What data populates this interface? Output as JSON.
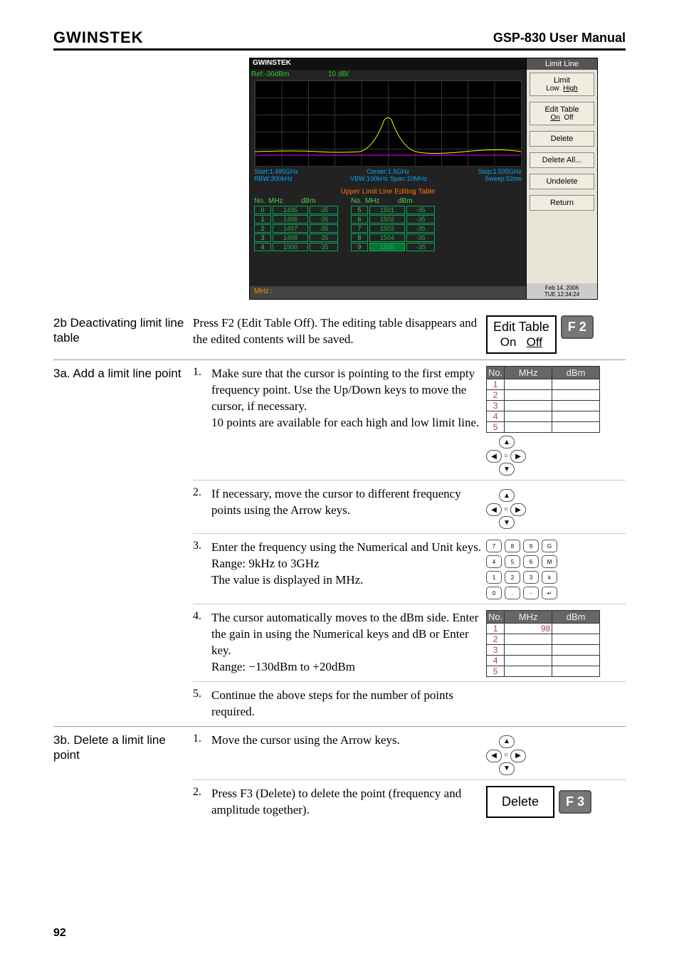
{
  "header": {
    "logo": "GWINSTEK",
    "title": "GSP-830 User Manual"
  },
  "screenshot": {
    "logo": "GWINSTEK",
    "ref": "Ref:-30dBm",
    "scale": "10 dB/",
    "info_l": "Start:1.495GHz",
    "info_c": "Center:1.5GHz",
    "info_r": "Stop:1.505GHz",
    "info_l2": "RBW:300kHz",
    "info_c2": "VBW:100kHz  Span:10MHz",
    "info_r2": "Sweep:52ms",
    "table_title": "Upper Limit Line Editing Table",
    "hdr": {
      "no": "No.",
      "mhz": "MHz",
      "dbm": "dBm"
    },
    "rows_left": [
      {
        "n": "0",
        "m": "1495",
        "d": "-35"
      },
      {
        "n": "1",
        "m": "1496",
        "d": "-35"
      },
      {
        "n": "2",
        "m": "1497",
        "d": "-35"
      },
      {
        "n": "3",
        "m": "1498",
        "d": "-35"
      },
      {
        "n": "4",
        "m": "1500",
        "d": "-35"
      }
    ],
    "rows_right": [
      {
        "n": "5",
        "m": "1501",
        "d": "-35"
      },
      {
        "n": "6",
        "m": "1502",
        "d": "-35"
      },
      {
        "n": "7",
        "m": "1503",
        "d": "-35"
      },
      {
        "n": "8",
        "m": "1504",
        "d": "-35"
      },
      {
        "n": "9",
        "m": "1505",
        "d": "-35"
      }
    ],
    "footer_l": "MHz :",
    "side_title": "Limit Line",
    "side_btn1_t": "Limit",
    "side_btn1_b_low": "Low",
    "side_btn1_b_high": "High",
    "side_btn2_t": "Edit Table",
    "side_btn2_b_on": "On",
    "side_btn2_b_off": "Off",
    "side_btn3": "Delete",
    "side_btn4": "Delete All...",
    "side_btn5": "Undelete",
    "side_btn6": "Return",
    "date1": "Feb 14, 2006",
    "date2": "TUE 12:34:24"
  },
  "sec_2b": {
    "label": "2b Deactivating limit line table",
    "text": "Press F2 (Edit Table Off). The editing table disappears and the edited contents will be saved.",
    "btn_t": "Edit Table",
    "btn_on": "On",
    "btn_off": "Off",
    "key": "F 2"
  },
  "sec_3a": {
    "label": "3a. Add a limit line point",
    "s1": "Make sure that the cursor is pointing to the first empty frequency point. Use the Up/Down keys to move the cursor, if necessary.\n10 points are available for each high and low limit line.",
    "s2": "If necessary, move the cursor to different frequency points using the Arrow keys.",
    "s3": "Enter the frequency using the Numerical and Unit keys.\nRange: 9kHz to 3GHz\nThe value is displayed in MHz.",
    "s4": "The cursor automatically moves to the dBm side. Enter the gain in using the Numerical keys and dB or Enter key.\nRange: −130dBm to +20dBm",
    "s5": "Continue the above steps for the number of points required.",
    "th_no": "No.",
    "th_mhz": "MHz",
    "th_dbm": "dBm",
    "row_nums": [
      "1",
      "2",
      "3",
      "4",
      "5"
    ],
    "val98": "98"
  },
  "sec_3b": {
    "label": "3b. Delete a limit line point",
    "s1": "Move the cursor using the Arrow keys.",
    "s2": "Press F3 (Delete) to delete the point (frequency and amplitude together).",
    "btn": "Delete",
    "key": "F 3"
  },
  "page_num": "92"
}
